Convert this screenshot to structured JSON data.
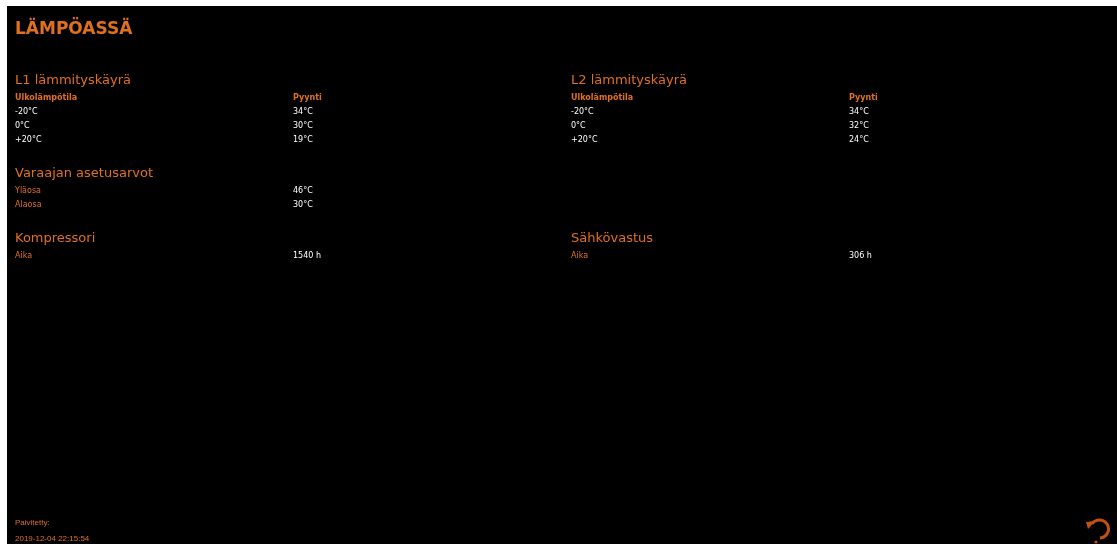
{
  "title": "LÄMPÖASSÄ",
  "sections": [
    {
      "kind": "curve",
      "heading": "L1 lämmityskäyrä",
      "columns": [
        "Ulkolämpötila",
        "Pyynti"
      ],
      "rows": [
        [
          "-20°C",
          "34°C"
        ],
        [
          "0°C",
          "30°C"
        ],
        [
          "+20°C",
          "19°C"
        ]
      ]
    },
    {
      "kind": "curve",
      "heading": "L2 lämmityskäyrä",
      "columns": [
        "Ulkolämpötila",
        "Pyynti"
      ],
      "rows": [
        [
          "-20°C",
          "34°C"
        ],
        [
          "0°C",
          "32°C"
        ],
        [
          "+20°C",
          "24°C"
        ]
      ]
    },
    {
      "kind": "values",
      "heading": "Varaajan asetusarvot",
      "rows": [
        [
          "Yläosa",
          "46°C"
        ],
        [
          "Alaosa",
          "30°C"
        ]
      ]
    },
    {
      "kind": "empty"
    },
    {
      "kind": "values",
      "heading": "Kompressori",
      "rows": [
        [
          "Aika",
          "1540 h"
        ]
      ]
    },
    {
      "kind": "values",
      "heading": "Sähkövastus",
      "rows": [
        [
          "Aika",
          "306 h"
        ]
      ]
    }
  ],
  "footer": {
    "label": "Paivitetty:",
    "timestamp": "2019-12-04 22:15:54"
  }
}
